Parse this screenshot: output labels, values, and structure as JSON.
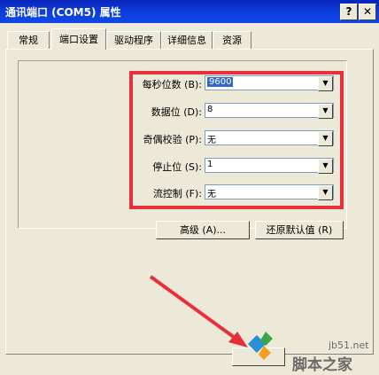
{
  "window": {
    "title": "通讯端口 (COM5) 属性",
    "help_glyph": "?",
    "close_glyph": "✕"
  },
  "tabs": [
    {
      "label": "常规"
    },
    {
      "label": "端口设置"
    },
    {
      "label": "驱动程序"
    },
    {
      "label": "详细信息"
    },
    {
      "label": "资源"
    }
  ],
  "settings": {
    "bits_per_second": {
      "label": "每秒位数 (B):",
      "value": "9600"
    },
    "data_bits": {
      "label": "数据位 (D):",
      "value": "8"
    },
    "parity": {
      "label": "奇偶校验 (P):",
      "value": "无"
    },
    "stop_bits": {
      "label": "停止位 (S):",
      "value": "1"
    },
    "flow_control": {
      "label": "流控制 (F):",
      "value": "无"
    }
  },
  "buttons": {
    "advanced": "高级 (A)...",
    "restore_defaults": "还原默认值 (R)"
  },
  "watermark": {
    "site": "jb51.net",
    "brand": "脚本之家"
  },
  "colors": {
    "highlight": "#e8303a",
    "titlebar": "#0b3ad8"
  },
  "icons": {
    "dropdown": "▼"
  }
}
